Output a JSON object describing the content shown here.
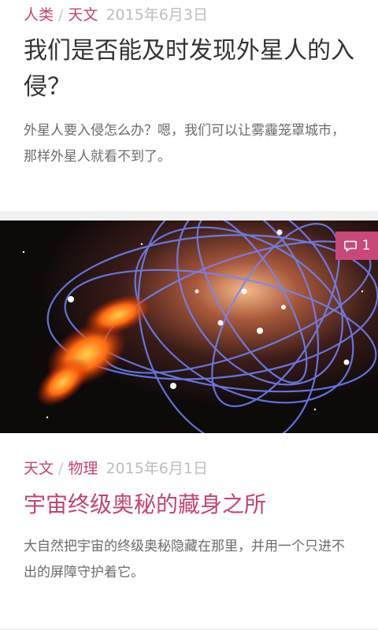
{
  "posts": [
    {
      "categories": [
        "人类",
        "天文"
      ],
      "separator": "/",
      "date": "2015年6月3日",
      "title": "我们是否能及时发现外星人的入侵？",
      "excerpt": "外星人要入侵怎么办？嗯，我们可以让雾霾笼罩城市，那样外星人就看不到了。"
    },
    {
      "categories": [
        "天文",
        "物理"
      ],
      "separator": "/",
      "date": "2015年6月1日",
      "title": "宇宙终级奥秘的藏身之所",
      "excerpt": "大自然把宇宙的终级奥秘隐藏在那里，并用一个只进不出的屏障守护着它。",
      "comment_count": "1",
      "comment_icon": "comment-bubble-icon"
    }
  ],
  "colors": {
    "category": "#c2466c",
    "badge": "#c9487a",
    "title2": "#c2466c"
  }
}
